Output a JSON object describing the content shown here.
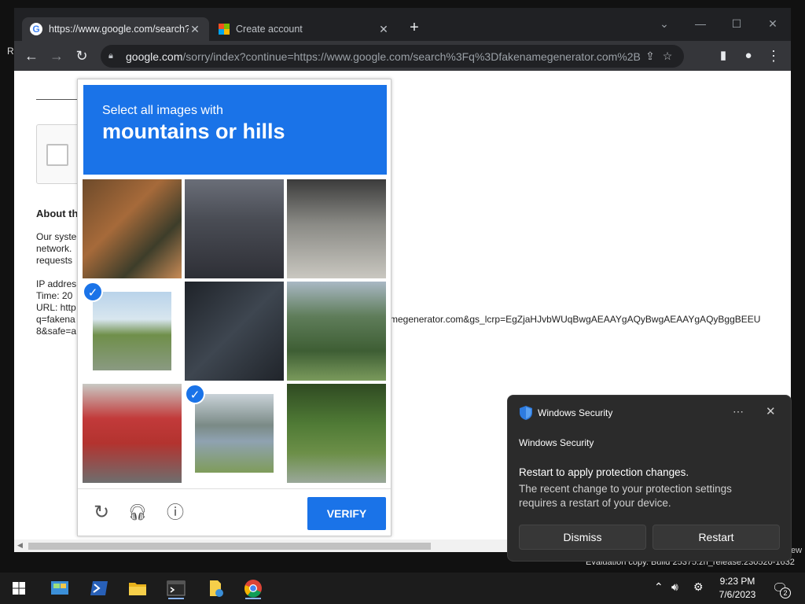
{
  "desktop": {
    "partial_label": "R",
    "partial_label2": "ew",
    "watermark": "Evaluation copy. Build 25375.zn_release.230520-1632"
  },
  "browser": {
    "tabs": [
      {
        "title": "https://www.google.com/search?",
        "icon": "google-favicon"
      },
      {
        "title": "Create account",
        "icon": "microsoft-favicon"
      }
    ],
    "url_host": "google.com",
    "url_path": "/sorry/index?continue=https://www.google.com/search%3Fq%3Dfakenamegenerator.com%2B..."
  },
  "page": {
    "about_heading": "About th",
    "para_lines": [
      "Our syste",
      "network.",
      "requests"
    ],
    "ip_lines": [
      "IP addres",
      "Time: 20",
      "URL: http",
      "q=fakena",
      "8&safe=a"
    ],
    "url_tail": "megenerator.com&gs_lcrp=EgZjaHJvbWUqBwgAEAAYgAQyBwgAEAAYgAQyBggBEEU"
  },
  "captcha": {
    "prompt_line1": "Select all images with",
    "prompt_line2": "mountains or hills",
    "verify_label": "VERIFY",
    "tiles": [
      {
        "desc": "bicycle",
        "selected": false
      },
      {
        "desc": "street",
        "selected": false
      },
      {
        "desc": "bicycle-pole",
        "selected": false
      },
      {
        "desc": "hills-road",
        "selected": true
      },
      {
        "desc": "motorcycle",
        "selected": false
      },
      {
        "desc": "mountain-valley",
        "selected": false
      },
      {
        "desc": "bus",
        "selected": false
      },
      {
        "desc": "lake-hills",
        "selected": true
      },
      {
        "desc": "forest-hill",
        "selected": false
      }
    ],
    "accent": "#1a73e8"
  },
  "toast": {
    "app_name": "Windows Security",
    "title": "Windows Security",
    "heading": "Restart to apply protection changes.",
    "body": "The recent change to your protection settings requires a restart of your device.",
    "dismiss_label": "Dismiss",
    "restart_label": "Restart"
  },
  "taskbar": {
    "time": "9:23 PM",
    "date": "7/6/2023",
    "notification_count": "2"
  }
}
